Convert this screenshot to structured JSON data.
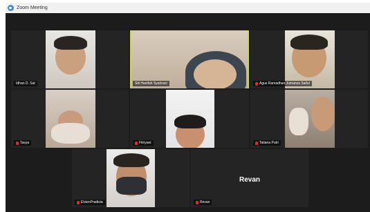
{
  "window": {
    "title": "Zoom Meeting"
  },
  "participants": [
    {
      "name": "Idhan D. Sat",
      "muted": false
    },
    {
      "name": "Siti Hanifah Syahrani",
      "muted": false,
      "active_speaker": true
    },
    {
      "name": "Agus Ramadhan Jumanza Saiful",
      "muted": true
    },
    {
      "name": "Tasya",
      "muted": true
    },
    {
      "name": "Fitriyani",
      "muted": true
    },
    {
      "name": "Tatiana Putri",
      "muted": true
    },
    {
      "name": "ElvienPradisia",
      "muted": true
    },
    {
      "name": "Revan",
      "muted": true,
      "video_off": true,
      "display_name": "Revan"
    }
  ],
  "colors": {
    "active_border": "#c9d84b",
    "muted_icon": "#e02828",
    "background": "#1c1c1c"
  }
}
